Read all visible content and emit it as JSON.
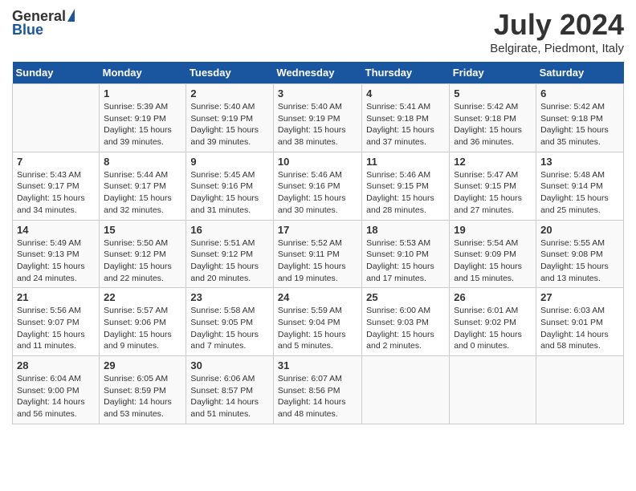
{
  "header": {
    "logo_general": "General",
    "logo_blue": "Blue",
    "month_year": "July 2024",
    "location": "Belgirate, Piedmont, Italy"
  },
  "calendar": {
    "days_of_week": [
      "Sunday",
      "Monday",
      "Tuesday",
      "Wednesday",
      "Thursday",
      "Friday",
      "Saturday"
    ],
    "weeks": [
      [
        {
          "day": "",
          "info": ""
        },
        {
          "day": "1",
          "info": "Sunrise: 5:39 AM\nSunset: 9:19 PM\nDaylight: 15 hours\nand 39 minutes."
        },
        {
          "day": "2",
          "info": "Sunrise: 5:40 AM\nSunset: 9:19 PM\nDaylight: 15 hours\nand 39 minutes."
        },
        {
          "day": "3",
          "info": "Sunrise: 5:40 AM\nSunset: 9:19 PM\nDaylight: 15 hours\nand 38 minutes."
        },
        {
          "day": "4",
          "info": "Sunrise: 5:41 AM\nSunset: 9:18 PM\nDaylight: 15 hours\nand 37 minutes."
        },
        {
          "day": "5",
          "info": "Sunrise: 5:42 AM\nSunset: 9:18 PM\nDaylight: 15 hours\nand 36 minutes."
        },
        {
          "day": "6",
          "info": "Sunrise: 5:42 AM\nSunset: 9:18 PM\nDaylight: 15 hours\nand 35 minutes."
        }
      ],
      [
        {
          "day": "7",
          "info": "Sunrise: 5:43 AM\nSunset: 9:17 PM\nDaylight: 15 hours\nand 34 minutes."
        },
        {
          "day": "8",
          "info": "Sunrise: 5:44 AM\nSunset: 9:17 PM\nDaylight: 15 hours\nand 32 minutes."
        },
        {
          "day": "9",
          "info": "Sunrise: 5:45 AM\nSunset: 9:16 PM\nDaylight: 15 hours\nand 31 minutes."
        },
        {
          "day": "10",
          "info": "Sunrise: 5:46 AM\nSunset: 9:16 PM\nDaylight: 15 hours\nand 30 minutes."
        },
        {
          "day": "11",
          "info": "Sunrise: 5:46 AM\nSunset: 9:15 PM\nDaylight: 15 hours\nand 28 minutes."
        },
        {
          "day": "12",
          "info": "Sunrise: 5:47 AM\nSunset: 9:15 PM\nDaylight: 15 hours\nand 27 minutes."
        },
        {
          "day": "13",
          "info": "Sunrise: 5:48 AM\nSunset: 9:14 PM\nDaylight: 15 hours\nand 25 minutes."
        }
      ],
      [
        {
          "day": "14",
          "info": "Sunrise: 5:49 AM\nSunset: 9:13 PM\nDaylight: 15 hours\nand 24 minutes."
        },
        {
          "day": "15",
          "info": "Sunrise: 5:50 AM\nSunset: 9:12 PM\nDaylight: 15 hours\nand 22 minutes."
        },
        {
          "day": "16",
          "info": "Sunrise: 5:51 AM\nSunset: 9:12 PM\nDaylight: 15 hours\nand 20 minutes."
        },
        {
          "day": "17",
          "info": "Sunrise: 5:52 AM\nSunset: 9:11 PM\nDaylight: 15 hours\nand 19 minutes."
        },
        {
          "day": "18",
          "info": "Sunrise: 5:53 AM\nSunset: 9:10 PM\nDaylight: 15 hours\nand 17 minutes."
        },
        {
          "day": "19",
          "info": "Sunrise: 5:54 AM\nSunset: 9:09 PM\nDaylight: 15 hours\nand 15 minutes."
        },
        {
          "day": "20",
          "info": "Sunrise: 5:55 AM\nSunset: 9:08 PM\nDaylight: 15 hours\nand 13 minutes."
        }
      ],
      [
        {
          "day": "21",
          "info": "Sunrise: 5:56 AM\nSunset: 9:07 PM\nDaylight: 15 hours\nand 11 minutes."
        },
        {
          "day": "22",
          "info": "Sunrise: 5:57 AM\nSunset: 9:06 PM\nDaylight: 15 hours\nand 9 minutes."
        },
        {
          "day": "23",
          "info": "Sunrise: 5:58 AM\nSunset: 9:05 PM\nDaylight: 15 hours\nand 7 minutes."
        },
        {
          "day": "24",
          "info": "Sunrise: 5:59 AM\nSunset: 9:04 PM\nDaylight: 15 hours\nand 5 minutes."
        },
        {
          "day": "25",
          "info": "Sunrise: 6:00 AM\nSunset: 9:03 PM\nDaylight: 15 hours\nand 2 minutes."
        },
        {
          "day": "26",
          "info": "Sunrise: 6:01 AM\nSunset: 9:02 PM\nDaylight: 15 hours\nand 0 minutes."
        },
        {
          "day": "27",
          "info": "Sunrise: 6:03 AM\nSunset: 9:01 PM\nDaylight: 14 hours\nand 58 minutes."
        }
      ],
      [
        {
          "day": "28",
          "info": "Sunrise: 6:04 AM\nSunset: 9:00 PM\nDaylight: 14 hours\nand 56 minutes."
        },
        {
          "day": "29",
          "info": "Sunrise: 6:05 AM\nSunset: 8:59 PM\nDaylight: 14 hours\nand 53 minutes."
        },
        {
          "day": "30",
          "info": "Sunrise: 6:06 AM\nSunset: 8:57 PM\nDaylight: 14 hours\nand 51 minutes."
        },
        {
          "day": "31",
          "info": "Sunrise: 6:07 AM\nSunset: 8:56 PM\nDaylight: 14 hours\nand 48 minutes."
        },
        {
          "day": "",
          "info": ""
        },
        {
          "day": "",
          "info": ""
        },
        {
          "day": "",
          "info": ""
        }
      ]
    ]
  }
}
